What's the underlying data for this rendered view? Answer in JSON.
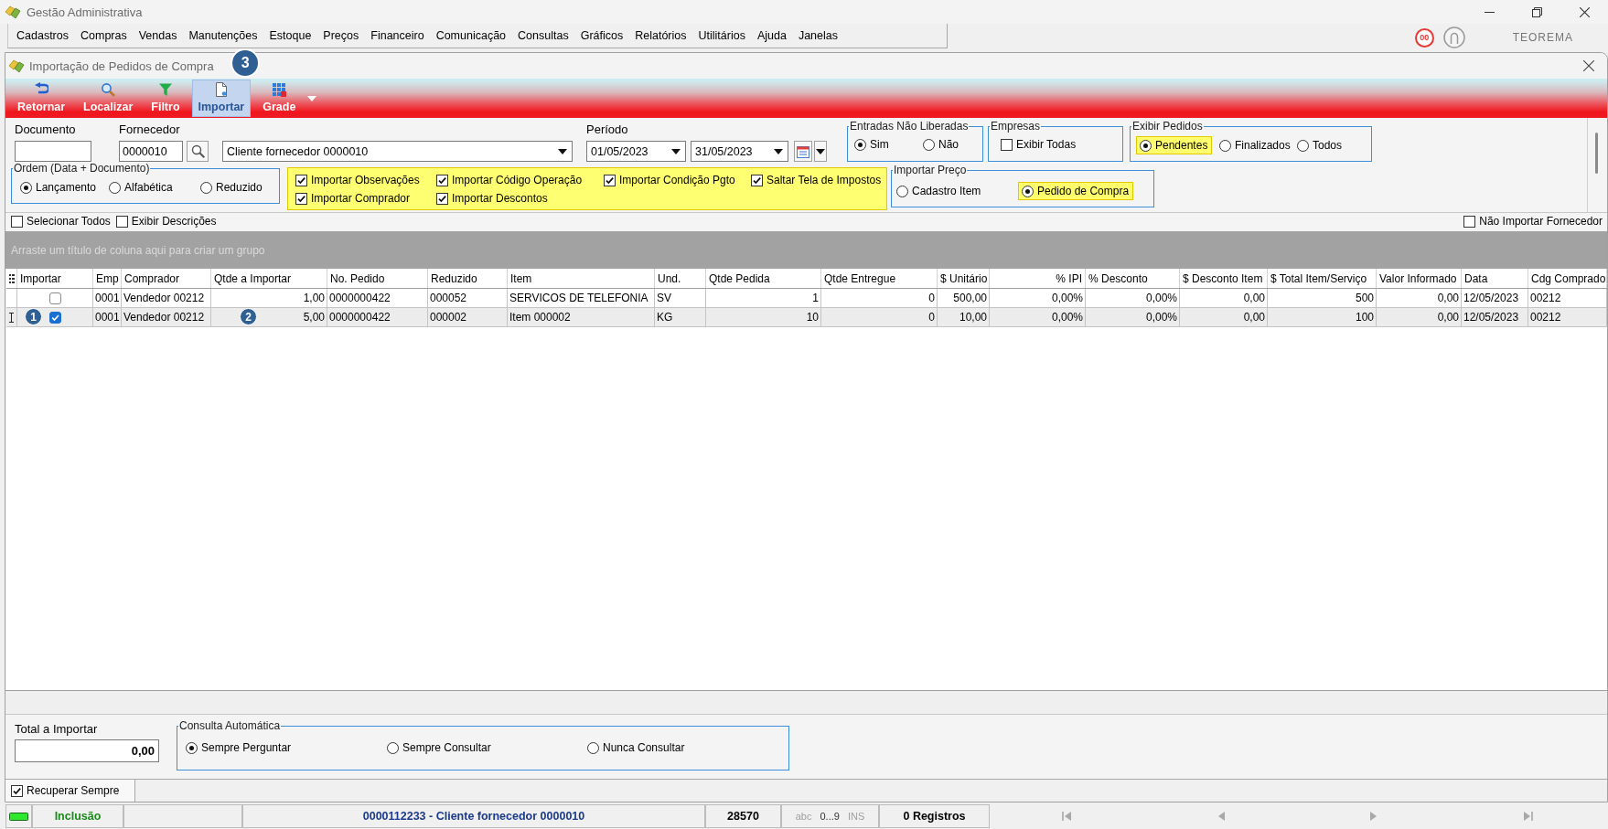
{
  "app_window": {
    "title": "Gestão Administrativa"
  },
  "menu_bar": {
    "items": [
      "Cadastros",
      "Compras",
      "Vendas",
      "Manutenções",
      "Estoque",
      "Preços",
      "Financeiro",
      "Comunicação",
      "Consultas",
      "Gráficos",
      "Relatórios",
      "Utilitários",
      "Ajuda",
      "Janelas"
    ],
    "notification_count": "00",
    "brand": "TEOREMA"
  },
  "child_window": {
    "title": "Importação de Pedidos de Compra"
  },
  "toolbar": {
    "buttons": [
      {
        "label": "Retornar",
        "kind": "return",
        "selected": false,
        "has_dropdown": false
      },
      {
        "label": "Localizar",
        "kind": "search",
        "selected": false,
        "has_dropdown": false
      },
      {
        "label": "Filtro",
        "kind": "filter",
        "selected": false,
        "has_dropdown": false
      },
      {
        "label": "Importar",
        "kind": "import",
        "selected": true,
        "has_dropdown": false,
        "callout": "3"
      },
      {
        "label": "Grade",
        "kind": "grid",
        "selected": false,
        "has_dropdown": true
      }
    ]
  },
  "filters": {
    "documento": {
      "label": "Documento"
    },
    "fornecedor": {
      "label": "Fornecedor",
      "code": "0000010",
      "name": "Cliente fornecedor 0000010"
    },
    "periodo": {
      "label": "Período",
      "start": "01/05/2023",
      "end": "31/05/2023"
    },
    "entradas_nao_liberadas": {
      "title": "Entradas Não Liberadas",
      "options": [
        {
          "label": "Sim",
          "selected": true
        },
        {
          "label": "Não",
          "selected": false
        }
      ]
    },
    "empresas": {
      "title": "Empresas",
      "options": [
        {
          "label": "Exibir Todas",
          "checked": false
        }
      ]
    },
    "exibir_pedidos": {
      "title": "Exibir Pedidos",
      "options": [
        {
          "label": "Pendentes",
          "selected": true,
          "highlighted": true
        },
        {
          "label": "Finalizados",
          "selected": false,
          "highlighted": false
        },
        {
          "label": "Todos",
          "selected": false,
          "highlighted": false
        }
      ]
    },
    "ordem": {
      "title": "Ordem (Data + Documento)",
      "options": [
        {
          "label": "Lançamento",
          "selected": true
        },
        {
          "label": "Alfabética",
          "selected": false
        },
        {
          "label": "Reduzido",
          "selected": false
        }
      ]
    },
    "import_options": {
      "highlighted": true,
      "options": [
        {
          "label": "Importar Observações",
          "checked": true
        },
        {
          "label": "Importar Código Operação",
          "checked": true
        },
        {
          "label": "Importar Condição Pgto",
          "checked": true
        },
        {
          "label": "Saltar Tela de Impostos",
          "checked": true
        },
        {
          "label": "Importar Comprador",
          "checked": true
        },
        {
          "label": "Importar Descontos",
          "checked": true
        }
      ]
    },
    "importar_preco": {
      "title": "Importar Preço",
      "options": [
        {
          "label": "Cadastro Item",
          "selected": false,
          "highlighted": false
        },
        {
          "label": "Pedido de Compra",
          "selected": true,
          "highlighted": true
        }
      ]
    }
  },
  "grid_options": {
    "left": [
      {
        "label": "Selecionar Todos",
        "checked": false
      },
      {
        "label": "Exibir Descrições",
        "checked": false
      }
    ],
    "right": [
      {
        "label": "Não Importar Fornecedor",
        "checked": false
      }
    ]
  },
  "group_panel": {
    "hint": "Arraste um título de coluna aqui para criar um grupo"
  },
  "table": {
    "columns": [
      {
        "label": "Importar",
        "kind": "check"
      },
      {
        "label": "Emp",
        "kind": "text"
      },
      {
        "label": "Comprador",
        "kind": "text"
      },
      {
        "label": "Qtde a Importar",
        "kind": "number"
      },
      {
        "label": "No. Pedido",
        "kind": "text"
      },
      {
        "label": "Reduzido",
        "kind": "text"
      },
      {
        "label": "Item",
        "kind": "text"
      },
      {
        "label": "Und.",
        "kind": "text"
      },
      {
        "label": "Qtde Pedida",
        "kind": "number"
      },
      {
        "label": "Qtde Entregue",
        "kind": "number"
      },
      {
        "label": "$ Unitário",
        "kind": "number"
      },
      {
        "label": "% IPI",
        "kind": "number"
      },
      {
        "label": "% Desconto",
        "kind": "number"
      },
      {
        "label": "$ Desconto Item",
        "kind": "number"
      },
      {
        "label": "$ Total Item/Serviço",
        "kind": "number"
      },
      {
        "label": "Valor Informado",
        "kind": "number"
      },
      {
        "label": "Data",
        "kind": "text"
      },
      {
        "label": "Cdg Comprado",
        "kind": "text"
      }
    ],
    "rows": [
      {
        "selected": false,
        "cells": [
          {
            "checked": false
          },
          {
            "text": "0001"
          },
          {
            "text": "Vendedor 00212"
          },
          {
            "text": "1,00"
          },
          {
            "text": "0000000422"
          },
          {
            "text": "000052"
          },
          {
            "text": "SERVICOS DE TELEFONIA"
          },
          {
            "text": "SV"
          },
          {
            "text": "1"
          },
          {
            "text": "0"
          },
          {
            "text": "500,00"
          },
          {
            "text": "0,00%"
          },
          {
            "text": "0,00%"
          },
          {
            "text": "0,00"
          },
          {
            "text": "500"
          },
          {
            "text": "0,00"
          },
          {
            "text": "12/05/2023"
          },
          {
            "text": "00212"
          }
        ]
      },
      {
        "selected": true,
        "cells": [
          {
            "checked": true,
            "callout": "1"
          },
          {
            "text": "0001"
          },
          {
            "text": "Vendedor 00212"
          },
          {
            "text": "5,00",
            "callout": "2"
          },
          {
            "text": "0000000422"
          },
          {
            "text": "000002"
          },
          {
            "text": "Item 000002"
          },
          {
            "text": "KG"
          },
          {
            "text": "10"
          },
          {
            "text": "0"
          },
          {
            "text": "10,00"
          },
          {
            "text": "0,00%"
          },
          {
            "text": "0,00%"
          },
          {
            "text": "0,00"
          },
          {
            "text": "100"
          },
          {
            "text": "0,00"
          },
          {
            "text": "12/05/2023"
          },
          {
            "text": "00212"
          }
        ]
      }
    ]
  },
  "bottom_panel": {
    "total_label": "Total a Importar",
    "total_value": "0,00",
    "consulta_automatica": {
      "title": "Consulta Automática",
      "options": [
        {
          "label": "Sempre Perguntar",
          "selected": true
        },
        {
          "label": "Sempre Consultar",
          "selected": false
        },
        {
          "label": "Nunca Consultar",
          "selected": false
        }
      ]
    }
  },
  "footer_tab": {
    "label": "Recuperar Sempre",
    "checked": true
  },
  "status_bar": {
    "mode": "Inclusão",
    "record": "0000112233 - Cliente fornecedor 0000010",
    "code": "28570",
    "indicators": [
      {
        "label": "abc",
        "active": false
      },
      {
        "label": "0...9",
        "active": true
      },
      {
        "label": "INS",
        "active": false
      }
    ],
    "records": "0 Registros"
  }
}
